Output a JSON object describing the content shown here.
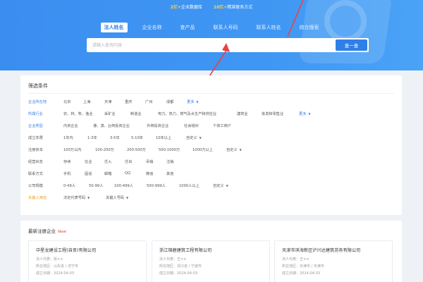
{
  "hero": {
    "stats": {
      "a_num": "2亿+",
      "a_label": "企业数据库",
      "b_num": "10亿+",
      "b_label": "精准联系方式"
    },
    "tabs": [
      "法人姓名",
      "企业名称",
      "查产品",
      "联系人号码",
      "联系人姓名",
      "综合搜索"
    ],
    "search": {
      "placeholder": "请输入查询内容",
      "button": "查一查"
    }
  },
  "filters": {
    "title": "筛选条件",
    "rows": [
      {
        "label": "企业所在地",
        "options": [
          "北京",
          "上海",
          "天津",
          "重庆",
          "广州",
          "成都"
        ],
        "more": "更多"
      },
      {
        "label": "所属行业",
        "options": [
          "农、林、牧、渔业",
          "采矿业",
          "制造业",
          "电力、热力、燃气及水生产和供应业",
          "建筑业",
          "批发和零售业"
        ],
        "more": "更多"
      },
      {
        "label": "企业类型",
        "options": [
          "内资企业",
          "港、澳、台商投资企业",
          "外商投资企业",
          "社会组织",
          "个体工商户"
        ]
      },
      {
        "label": "成立年限",
        "options": [
          "1年内",
          "1-3年",
          "3-5年",
          "5-10年",
          "10年以上",
          "自定义"
        ]
      },
      {
        "label": "注册资本",
        "options": [
          "100万以内",
          "100-200万",
          "200-500万",
          "500-1000万",
          "1000万以上",
          "自定义"
        ]
      },
      {
        "label": "经营状态",
        "options": [
          "存续",
          "在业",
          "迁入",
          "迁出",
          "吊销",
          "注销"
        ]
      },
      {
        "label": "联系方式",
        "options": [
          "手机",
          "固话",
          "邮箱",
          "QQ",
          "微信",
          "其他"
        ]
      },
      {
        "label": "公司规模",
        "options": [
          "0-49人",
          "50-99人",
          "100-499人",
          "500-999人",
          "1000人以上",
          "自定义"
        ]
      },
      {
        "label": "关键人筛选",
        "options": [
          "法定代表号码",
          "关键人号码"
        ]
      }
    ]
  },
  "latest": {
    "title": "最新注册企业",
    "badge": "New",
    "cards": [
      {
        "name": "中星龙建设工程(自贡)有限公司",
        "legal": "法人代表：张××",
        "region": "所在地区：山东省 / 济宁市",
        "date": "成立日期：2024-04-03"
      },
      {
        "name": "浙江锦碧建筑工程有限公司",
        "legal": "法人代表：王××",
        "region": "所在地区：浙江省 / 宁波市",
        "date": "成立日期：2024-04-03"
      },
      {
        "name": "天津市滨海新区沪兴达建筑劳务有限公司",
        "legal": "法人代表：王××",
        "region": "所在地区：天津市 / 天津市",
        "date": "成立日期：2024-04-03"
      }
    ]
  }
}
